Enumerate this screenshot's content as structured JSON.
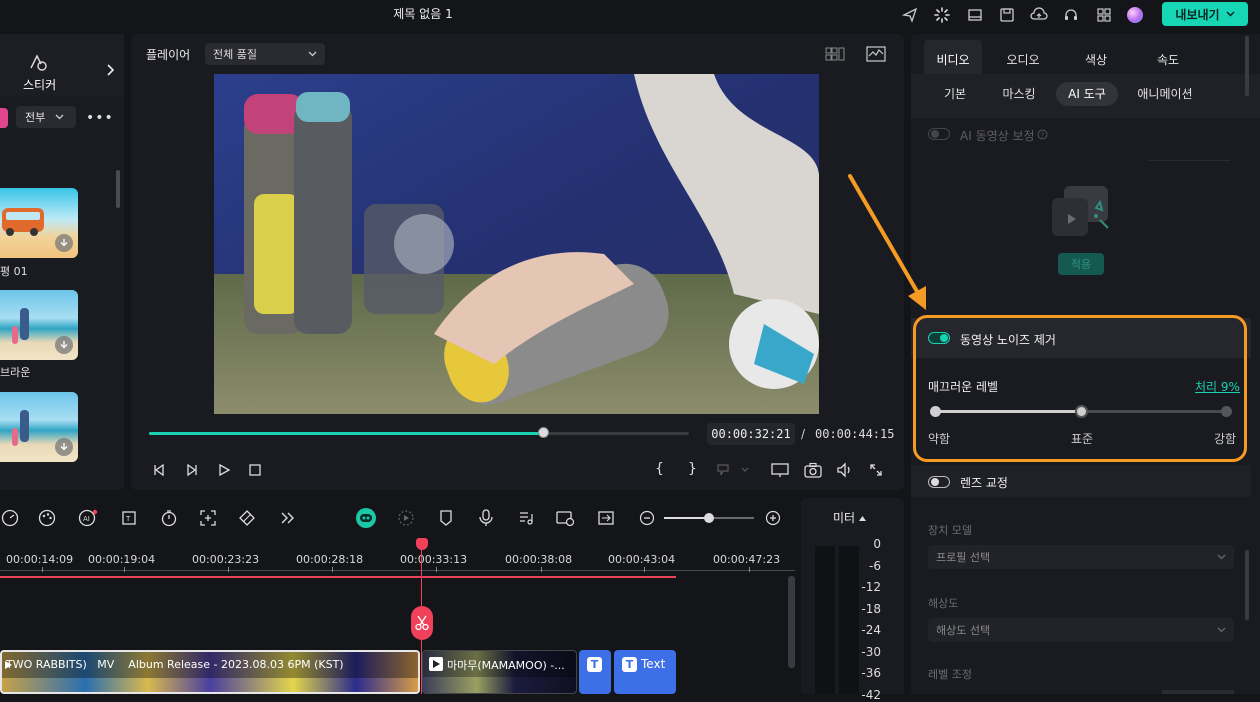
{
  "window": {
    "title": "제목 없음 1",
    "export_label": "내보내기"
  },
  "left_panel": {
    "sticker_label": "스티커",
    "filter_label": "전부",
    "items": [
      {
        "label": "평 01"
      },
      {
        "label": "브라운"
      },
      {
        "label": ""
      }
    ]
  },
  "player": {
    "label": "플레이어",
    "quality": "전체 품질",
    "current_time": "00:00:32:21",
    "separator": "/",
    "total_time": "00:00:44:15",
    "progress": 0.73
  },
  "right_panel": {
    "tabs": [
      "비디오",
      "오디오",
      "색상",
      "속도"
    ],
    "active_tab": "비디오",
    "subtabs": [
      "기본",
      "마스킹",
      "AI 도구",
      "애니메이션"
    ],
    "active_subtab": "AI 도구",
    "ai_correction_label": "AI 동영상 보정",
    "ai_apply_label": "적용",
    "denoise_label": "동영상 노이즈 제거",
    "smooth_label": "매끄러운 레벨",
    "smooth_value": "처리 9%",
    "slider_labels": [
      "약함",
      "표준",
      "강함"
    ],
    "slider_value": 0.5,
    "lens_label": "렌즈 교정",
    "device_model_label": "장치 모델",
    "device_model_placeholder": "프로필 선택",
    "resolution_label": "해상도",
    "resolution_placeholder": "해상도 선택",
    "level_label": "레벨 조정"
  },
  "timeline": {
    "ticks": [
      "00:00:14:09",
      "00:00:19:04",
      "00:00:23:23",
      "00:00:28:18",
      "00:00:33:13",
      "00:00:38:08",
      "00:00:43:04",
      "00:00:47:23"
    ],
    "clips": [
      {
        "label": "TWO RABBITS)   MV    Album Release - 2023.08.03 6PM (KST)"
      },
      {
        "label": "마마무(MAMAMOO) -..."
      },
      {
        "label": ""
      },
      {
        "label": "Text"
      }
    ]
  },
  "meter": {
    "label": "미터",
    "db": [
      "0",
      "-6",
      "-12",
      "-18",
      "-24",
      "-30",
      "-36",
      "-42"
    ]
  },
  "colors": {
    "accent": "#19d2b2",
    "highlight": "#f59a23",
    "playhead": "#f0405a",
    "text_clip": "#3d6fe6"
  }
}
